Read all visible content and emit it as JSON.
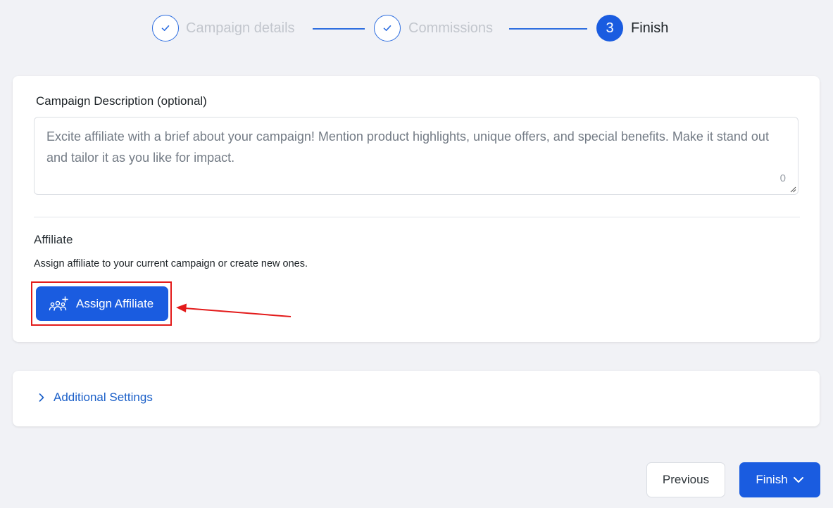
{
  "stepper": {
    "steps": [
      {
        "label": "Campaign details",
        "state": "done"
      },
      {
        "label": "Commissions",
        "state": "done"
      },
      {
        "number": "3",
        "label": "Finish",
        "state": "active"
      }
    ]
  },
  "description": {
    "label": "Campaign Description (optional)",
    "placeholder": "Excite affiliate with a brief about your campaign! Mention product highlights, unique offers, and special benefits. Make it stand out and tailor it as you like for impact.",
    "char_count": "0"
  },
  "affiliate": {
    "title": "Affiliate",
    "description": "Assign affiliate to your current campaign or create new ones.",
    "assign_button_label": "Assign Affiliate"
  },
  "additional_settings": {
    "label": "Additional Settings"
  },
  "footer": {
    "previous_label": "Previous",
    "finish_label": "Finish"
  },
  "colors": {
    "primary": "#1a5ce0",
    "link": "#1a5fc8",
    "annotation": "#e31b1b",
    "background": "#f1f2f6"
  }
}
